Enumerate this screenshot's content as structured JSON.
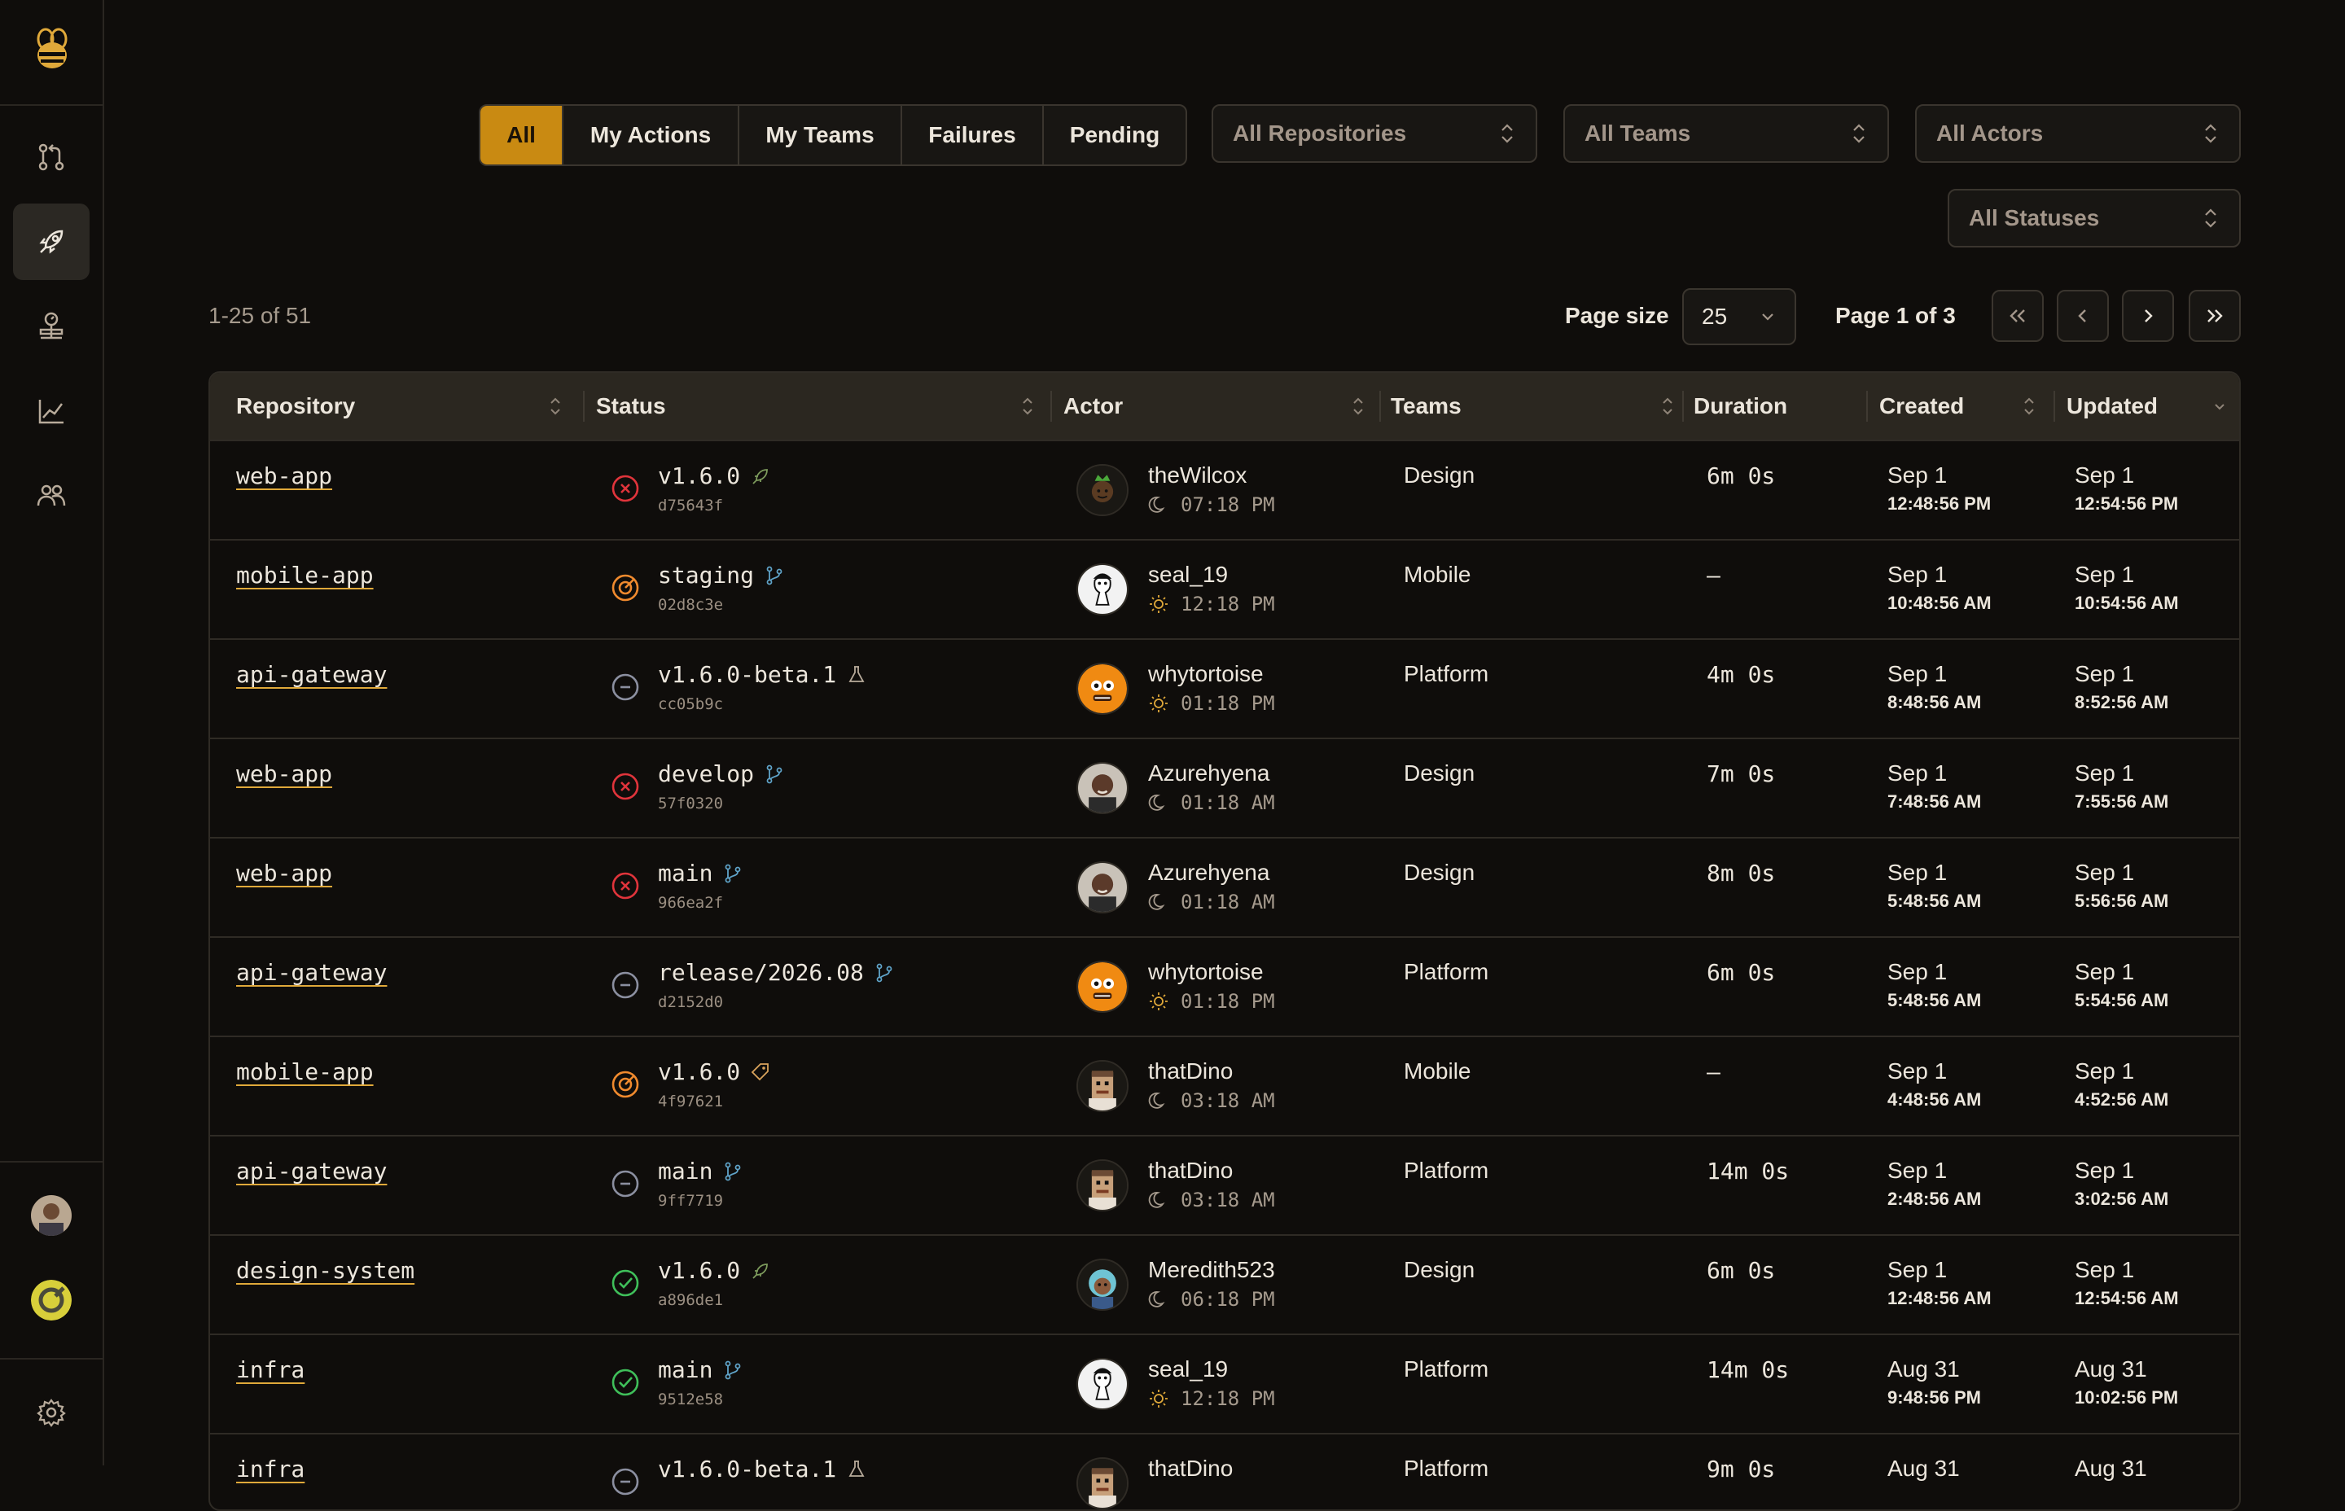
{
  "filters": {
    "tabs": [
      "All",
      "My Actions",
      "My Teams",
      "Failures",
      "Pending"
    ],
    "active_tab": "All",
    "repositories": "All Repositories",
    "teams": "All Teams",
    "actors": "All Actors",
    "statuses": "All Statuses"
  },
  "pagination": {
    "range": "1-25 of 51",
    "page_size_label": "Page size",
    "page_size": "25",
    "page_label": "Page 1 of 3"
  },
  "columns": {
    "repository": "Repository",
    "status": "Status",
    "actor": "Actor",
    "teams": "Teams",
    "duration": "Duration",
    "created": "Created",
    "updated": "Updated"
  },
  "rows": [
    {
      "repo": "web-app",
      "status": "failed",
      "ref": "v1.6.0",
      "ref_icon": "rocket-icon",
      "sha": "d75643f",
      "actor": "theWilcox",
      "time": "07:18 PM",
      "time_icon": "moon-icon",
      "team": "Design",
      "duration": "6m 0s",
      "created_date": "Sep 1",
      "created_time": "12:48:56 PM",
      "updated_date": "Sep 1",
      "updated_time": "12:54:56 PM"
    },
    {
      "repo": "mobile-app",
      "status": "running",
      "ref": "staging",
      "ref_icon": "branch-icon",
      "sha": "02d8c3e",
      "actor": "seal_19",
      "time": "12:18 PM",
      "time_icon": "sun-icon",
      "team": "Mobile",
      "duration": "–",
      "created_date": "Sep 1",
      "created_time": "10:48:56 AM",
      "updated_date": "Sep 1",
      "updated_time": "10:54:56 AM"
    },
    {
      "repo": "api-gateway",
      "status": "skipped",
      "ref": "v1.6.0-beta.1",
      "ref_icon": "flask-icon",
      "sha": "cc05b9c",
      "actor": "whytortoise",
      "time": "01:18 PM",
      "time_icon": "sun-icon",
      "team": "Platform",
      "duration": "4m 0s",
      "created_date": "Sep 1",
      "created_time": "8:48:56 AM",
      "updated_date": "Sep 1",
      "updated_time": "8:52:56 AM"
    },
    {
      "repo": "web-app",
      "status": "failed",
      "ref": "develop",
      "ref_icon": "branch-icon",
      "sha": "57f0320",
      "actor": "Azurehyena",
      "time": "01:18 AM",
      "time_icon": "moon-icon",
      "team": "Design",
      "duration": "7m 0s",
      "created_date": "Sep 1",
      "created_time": "7:48:56 AM",
      "updated_date": "Sep 1",
      "updated_time": "7:55:56 AM"
    },
    {
      "repo": "web-app",
      "status": "failed",
      "ref": "main",
      "ref_icon": "branch-icon",
      "sha": "966ea2f",
      "actor": "Azurehyena",
      "time": "01:18 AM",
      "time_icon": "moon-icon",
      "team": "Design",
      "duration": "8m 0s",
      "created_date": "Sep 1",
      "created_time": "5:48:56 AM",
      "updated_date": "Sep 1",
      "updated_time": "5:56:56 AM"
    },
    {
      "repo": "api-gateway",
      "status": "skipped",
      "ref": "release/2026.08",
      "ref_icon": "branch-icon",
      "sha": "d2152d0",
      "actor": "whytortoise",
      "time": "01:18 PM",
      "time_icon": "sun-icon",
      "team": "Platform",
      "duration": "6m 0s",
      "created_date": "Sep 1",
      "created_time": "5:48:56 AM",
      "updated_date": "Sep 1",
      "updated_time": "5:54:56 AM"
    },
    {
      "repo": "mobile-app",
      "status": "running",
      "ref": "v1.6.0",
      "ref_icon": "tag-icon",
      "sha": "4f97621",
      "actor": "thatDino",
      "time": "03:18 AM",
      "time_icon": "moon-icon",
      "team": "Mobile",
      "duration": "–",
      "created_date": "Sep 1",
      "created_time": "4:48:56 AM",
      "updated_date": "Sep 1",
      "updated_time": "4:52:56 AM"
    },
    {
      "repo": "api-gateway",
      "status": "skipped",
      "ref": "main",
      "ref_icon": "branch-icon",
      "sha": "9ff7719",
      "actor": "thatDino",
      "time": "03:18 AM",
      "time_icon": "moon-icon",
      "team": "Platform",
      "duration": "14m 0s",
      "created_date": "Sep 1",
      "created_time": "2:48:56 AM",
      "updated_date": "Sep 1",
      "updated_time": "3:02:56 AM"
    },
    {
      "repo": "design-system",
      "status": "success",
      "ref": "v1.6.0",
      "ref_icon": "rocket-icon",
      "sha": "a896de1",
      "actor": "Meredith523",
      "time": "06:18 PM",
      "time_icon": "moon-icon",
      "team": "Design",
      "duration": "6m 0s",
      "created_date": "Sep 1",
      "created_time": "12:48:56 AM",
      "updated_date": "Sep 1",
      "updated_time": "12:54:56 AM"
    },
    {
      "repo": "infra",
      "status": "success",
      "ref": "main",
      "ref_icon": "branch-icon",
      "sha": "9512e58",
      "actor": "seal_19",
      "time": "12:18 PM",
      "time_icon": "sun-icon",
      "team": "Platform",
      "duration": "14m 0s",
      "created_date": "Aug 31",
      "created_time": "9:48:56 PM",
      "updated_date": "Aug 31",
      "updated_time": "10:02:56 PM"
    },
    {
      "repo": "infra",
      "status": "skipped",
      "ref": "v1.6.0-beta.1",
      "ref_icon": "flask-icon",
      "sha": "",
      "actor": "thatDino",
      "time": "",
      "time_icon": "moon-icon",
      "team": "Platform",
      "duration": "9m 0s",
      "created_date": "Aug 31",
      "created_time": "",
      "updated_date": "Aug 31",
      "updated_time": ""
    }
  ],
  "colors": {
    "accent": "#c98a12",
    "failed": "#e0343b",
    "running": "#f08a2e",
    "success": "#3fbf5a",
    "skipped": "#8b8fa0",
    "link_underline": "#e0a93a"
  }
}
